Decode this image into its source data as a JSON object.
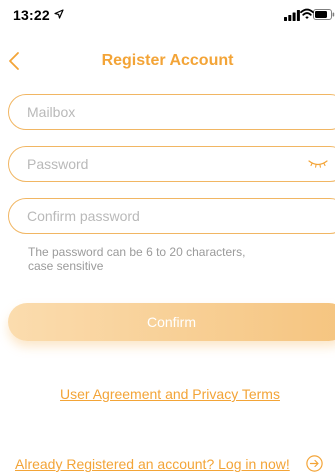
{
  "status_bar": {
    "time": "13:22",
    "icons": [
      "location-arrow-icon",
      "signal-icon",
      "wifi-icon",
      "battery-icon"
    ]
  },
  "nav": {
    "back_icon": "chevron-left-icon",
    "title": "Register Account"
  },
  "form": {
    "mailbox": {
      "value": "",
      "placeholder": "Mailbox"
    },
    "password": {
      "value": "",
      "placeholder": "Password",
      "toggle_icon": "eye-closed-icon"
    },
    "confirm_password": {
      "value": "",
      "placeholder": "Confirm password"
    },
    "hint_line1": "The password can be 6 to 20 characters,",
    "hint_line2": "case sensitive",
    "confirm_label": "Confirm"
  },
  "links": {
    "agreement": "User Agreement and Privacy Terms",
    "login": "Already Registered an account? Log in now!",
    "login_icon": "arrow-right-circle-icon"
  },
  "colors": {
    "accent": "#f3a437",
    "border": "#f1b663",
    "button_gradient_start": "#fbdcae",
    "button_gradient_end": "#f5c47f",
    "hint_text": "#9b9b9b",
    "placeholder": "#b9b9b9"
  }
}
